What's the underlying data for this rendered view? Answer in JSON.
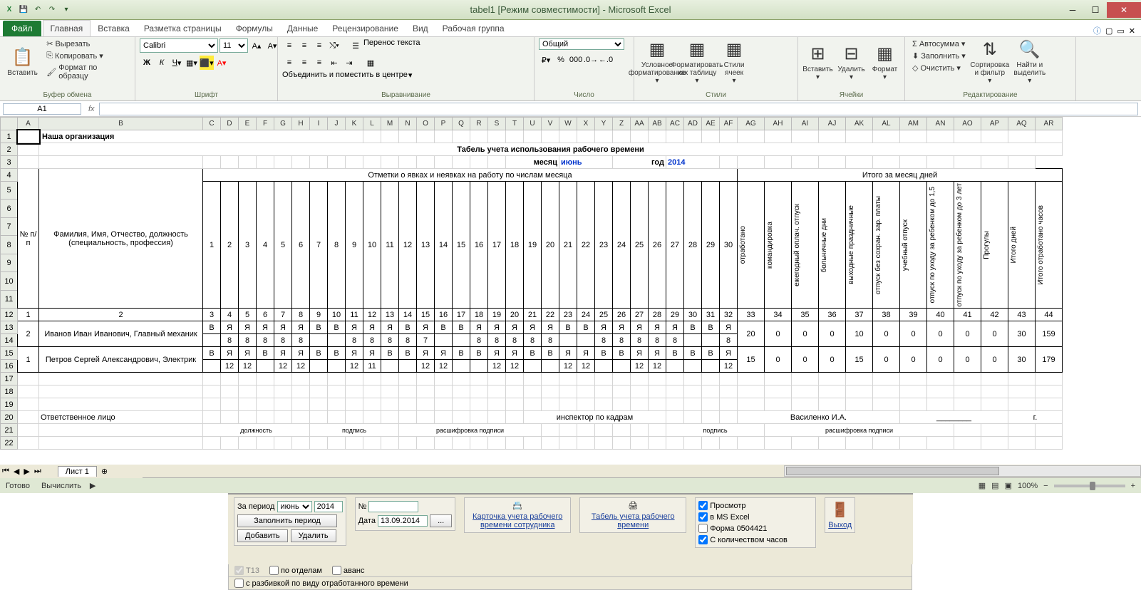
{
  "title": "tabel1  [Режим совместимости] - Microsoft Excel",
  "tabs": {
    "file": "Файл",
    "home": "Главная",
    "insert": "Вставка",
    "layout": "Разметка страницы",
    "formulas": "Формулы",
    "data": "Данные",
    "review": "Рецензирование",
    "view": "Вид",
    "workgroup": "Рабочая группа"
  },
  "ribbon": {
    "clipboard": {
      "paste": "Вставить",
      "cut": "Вырезать",
      "copy": "Копировать",
      "fmt": "Формат по образцу",
      "label": "Буфер обмена"
    },
    "font": {
      "name": "Calibri",
      "size": "11",
      "label": "Шрифт"
    },
    "align": {
      "wrap": "Перенос текста",
      "merge": "Объединить и поместить в центре",
      "label": "Выравнивание"
    },
    "number": {
      "general": "Общий",
      "label": "Число"
    },
    "styles": {
      "cond": "Условное форматирование",
      "table": "Форматировать как таблицу",
      "cell": "Стили ячеек",
      "label": "Стили"
    },
    "cells": {
      "insert": "Вставить",
      "delete": "Удалить",
      "format": "Формат",
      "label": "Ячейки"
    },
    "editing": {
      "sum": "Автосумма",
      "fill": "Заполнить",
      "clear": "Очистить",
      "sort": "Сортировка и фильтр",
      "find": "Найти и выделить",
      "label": "Редактирование"
    }
  },
  "namebox": "A1",
  "sheet": {
    "org": "Наша организация",
    "title": "Табель учета использования рабочего времени",
    "month_lbl": "месяц",
    "month": "июнь",
    "year_lbl": "год",
    "year": "2014",
    "col_headers": [
      "A",
      "B",
      "C",
      "D",
      "E",
      "F",
      "G",
      "H",
      "I",
      "J",
      "K",
      "L",
      "M",
      "N",
      "O",
      "P",
      "Q",
      "R",
      "S",
      "T",
      "U",
      "V",
      "W",
      "X",
      "Y",
      "Z",
      "AA",
      "AB",
      "AC",
      "AD",
      "AE",
      "AF",
      "AG",
      "AH",
      "AI",
      "AJ",
      "AK",
      "AL",
      "AM",
      "AN",
      "AO",
      "AP",
      "AQ",
      "AR"
    ],
    "h_num": "№ п/п",
    "h_fio": "Фамилия, Имя, Отчество, должность (специальность, профессия)",
    "h_marks": "Отметки о явках и неявках на работу по числам месяца",
    "h_total": "Итого за месяц дней",
    "days": [
      "1",
      "2",
      "3",
      "4",
      "5",
      "6",
      "7",
      "8",
      "9",
      "10",
      "11",
      "12",
      "13",
      "14",
      "15",
      "16",
      "17",
      "18",
      "19",
      "20",
      "21",
      "22",
      "23",
      "24",
      "25",
      "26",
      "27",
      "28",
      "29",
      "30"
    ],
    "vcols": [
      "отработано",
      "командировка",
      "ежегодный оплач. отпуск",
      "больничные дни",
      "выходные праздничные",
      "отпуск без сохран. зар. платы",
      "учебный отпуск",
      "отпуск по уходу за ребенком до 1,5",
      "отпуск по уходу за ребенком до 3 лет",
      "Прогулы",
      "Итого дней",
      "Итого отработано часов"
    ],
    "numrow": [
      "1",
      "2",
      "3",
      "4",
      "5",
      "6",
      "7",
      "8",
      "9",
      "10",
      "11",
      "12",
      "13",
      "14",
      "15",
      "16",
      "17",
      "18",
      "19",
      "20",
      "21",
      "22",
      "23",
      "24",
      "25",
      "26",
      "27",
      "28",
      "29",
      "30",
      "31",
      "32",
      "33",
      "34",
      "35",
      "36",
      "37",
      "38",
      "39",
      "40",
      "41",
      "42",
      "43",
      "44"
    ],
    "emp1": {
      "n": "2",
      "fio": "Иванов Иван Иванович, Главный механик",
      "r1": [
        "В",
        "Я",
        "Я",
        "Я",
        "Я",
        "Я",
        "В",
        "В",
        "Я",
        "Я",
        "Я",
        "В",
        "Я",
        "В",
        "В",
        "Я",
        "Я",
        "Я",
        "Я",
        "Я",
        "В",
        "В",
        "Я",
        "Я",
        "Я",
        "Я",
        "Я",
        "В",
        "В",
        "Я"
      ],
      "r2": [
        "",
        "8",
        "8",
        "8",
        "8",
        "8",
        "",
        "",
        "8",
        "8",
        "8",
        "8",
        "7",
        "",
        "",
        "8",
        "8",
        "8",
        "8",
        "8",
        "",
        "",
        "8",
        "8",
        "8",
        "8",
        "8",
        "",
        "",
        "8"
      ],
      "t": [
        "20",
        "0",
        "0",
        "0",
        "10",
        "0",
        "0",
        "0",
        "0",
        "0",
        "30",
        "159"
      ]
    },
    "emp2": {
      "n": "1",
      "fio": "Петров Сергей Александрович, Электрик",
      "r1": [
        "В",
        "Я",
        "Я",
        "В",
        "Я",
        "Я",
        "В",
        "В",
        "Я",
        "Я",
        "В",
        "В",
        "Я",
        "Я",
        "В",
        "В",
        "Я",
        "Я",
        "В",
        "В",
        "Я",
        "Я",
        "В",
        "В",
        "Я",
        "Я",
        "В",
        "В",
        "В",
        "Я"
      ],
      "r2": [
        "",
        "12",
        "12",
        "",
        "12",
        "12",
        "",
        "",
        "12",
        "11",
        "",
        "",
        "12",
        "12",
        "",
        "",
        "12",
        "12",
        "",
        "",
        "12",
        "12",
        "",
        "",
        "12",
        "12",
        "",
        "",
        "",
        "12"
      ],
      "t": [
        "15",
        "0",
        "0",
        "0",
        "15",
        "0",
        "0",
        "0",
        "0",
        "0",
        "30",
        "179"
      ]
    },
    "resp": "Ответственное лицо",
    "resp_pos": "должность",
    "resp_sign": "подпись",
    "resp_dec": "расшифровка подписи",
    "insp": "инспектор по кадрам",
    "vas": "Василенко И.А.",
    "g": "г.",
    "dash": "________"
  },
  "sheettab": "Лист 1",
  "status": {
    "ready": "Готово",
    "calc": "Вычислить",
    "zoom": "100%"
  },
  "panel": {
    "period": "За период",
    "month": "июнь",
    "year": "2014",
    "fill": "Заполнить период",
    "add": "Добавить",
    "del": "Удалить",
    "num": "№",
    "date": "Дата",
    "dateval": "13.09.2014",
    "card": "Карточка учета рабочего времени сотрудника",
    "tabel": "Табель учета рабочего времени",
    "preview": "Просмотр",
    "excel": "в MS Excel",
    "form": "Форма 0504421",
    "hours": "С количеством часов",
    "t13": "Т13",
    "dept": "по отделам",
    "avans": "аванс",
    "break": "с разбивкой по виду отработанного времени",
    "exit": "Выход"
  }
}
